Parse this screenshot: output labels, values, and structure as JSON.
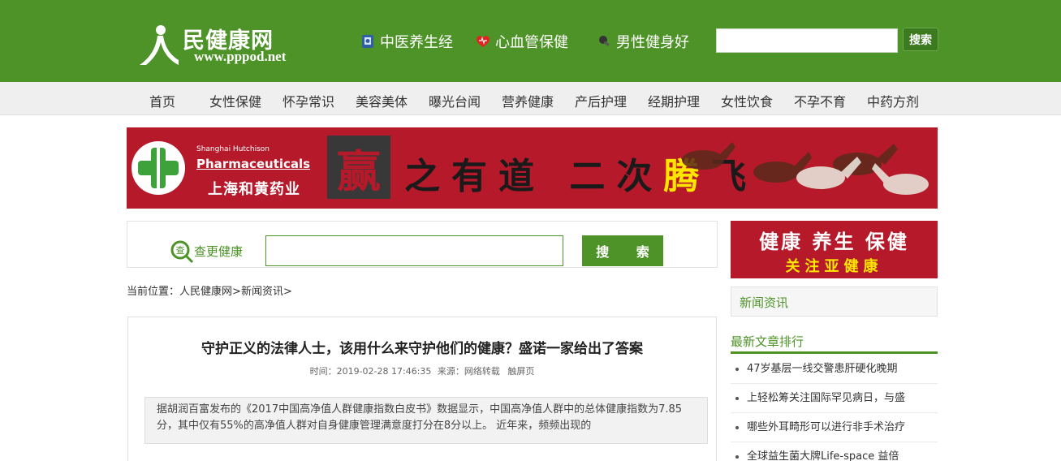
{
  "header": {
    "logo_title": "民健康网",
    "logo_url": "www.pppod.net",
    "links": [
      {
        "label": "中医养生经",
        "icon": "book-icon"
      },
      {
        "label": "心血管保健",
        "icon": "heart-icon"
      },
      {
        "label": "男性健身好",
        "icon": "fitness-icon"
      }
    ],
    "search_placeholder": "",
    "search_button": "搜索"
  },
  "menu": {
    "items": [
      "首页",
      "女性保健",
      "怀孕常识",
      "美容美体",
      "曝光台闻",
      "营养健康",
      "产后护理",
      "经期护理",
      "女性饮食",
      "不孕不育",
      "中药方剂"
    ]
  },
  "banner": {
    "company_en_small": "Shanghai Hutchison",
    "company_en": "Pharmaceuticals",
    "company_cn": "上海和黄药业",
    "win_char": "赢",
    "slogan_part1": "之有道 二次",
    "slogan_highlight": "腾",
    "slogan_part2": "飞"
  },
  "check": {
    "label": "查更健康",
    "input_value": "",
    "button": "搜 索"
  },
  "breadcrumb": {
    "prefix": "当前位置：",
    "home": "人民健康网",
    "sep1": ">",
    "section": "新闻资讯",
    "sep2": ">"
  },
  "article": {
    "title": "守护正义的法律人士，该用什么来守护他们的健康？盛诺一家给出了答案",
    "meta_time": "时间：2019-02-28 17:46:35",
    "meta_source": "来源：网络转载",
    "meta_touch": "触屏页",
    "summary": "据胡润百富发布的《2017中国高净值人群健康指数白皮书》数据显示，中国高净值人群中的总体健康指数为7.85分，其中仅有55%的高净值人群对自身健康管理满意度打分在8分以上。 近年来，频频出现的"
  },
  "sidebar": {
    "ad_line1": "健康 养生 保健",
    "ad_line2": "关注亚健康",
    "category": "新闻资讯",
    "rank_title": "最新文章排行",
    "rank_items": [
      "47岁基层一线交警患肝硬化晚期",
      "上轻松筹关注国际罕见病日，与盛",
      "哪些外耳畸形可以进行非手术治疗",
      "全球益生菌大牌Life-space 益倍"
    ]
  },
  "colors": {
    "brand_green": "#4e9328",
    "banner_red": "#b5192a",
    "highlight_yellow": "#ffe600"
  }
}
